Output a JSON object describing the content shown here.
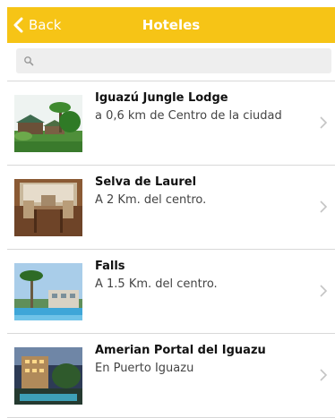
{
  "header": {
    "back_label": "Back",
    "title": "Hoteles"
  },
  "search": {
    "placeholder": "",
    "value": ""
  },
  "hotels": [
    {
      "name": "Iguazú Jungle Lodge",
      "subtitle": "a 0,6 km de Centro de la ciudad"
    },
    {
      "name": "Selva de Laurel",
      "subtitle": "A 2 Km. del centro."
    },
    {
      "name": "Falls",
      "subtitle": "A 1.5 Km. del centro."
    },
    {
      "name": "Amerian Portal del Iguazu",
      "subtitle": "En Puerto Iguazu"
    }
  ],
  "colors": {
    "navbar": "#f6c416",
    "navbar_text": "#ffffff",
    "search_bg": "#eeeeee",
    "divider": "#d8d8d8"
  },
  "icons": {
    "back": "chevron-left-icon",
    "search": "magnifier-icon",
    "disclosure": "chevron-right-icon"
  }
}
